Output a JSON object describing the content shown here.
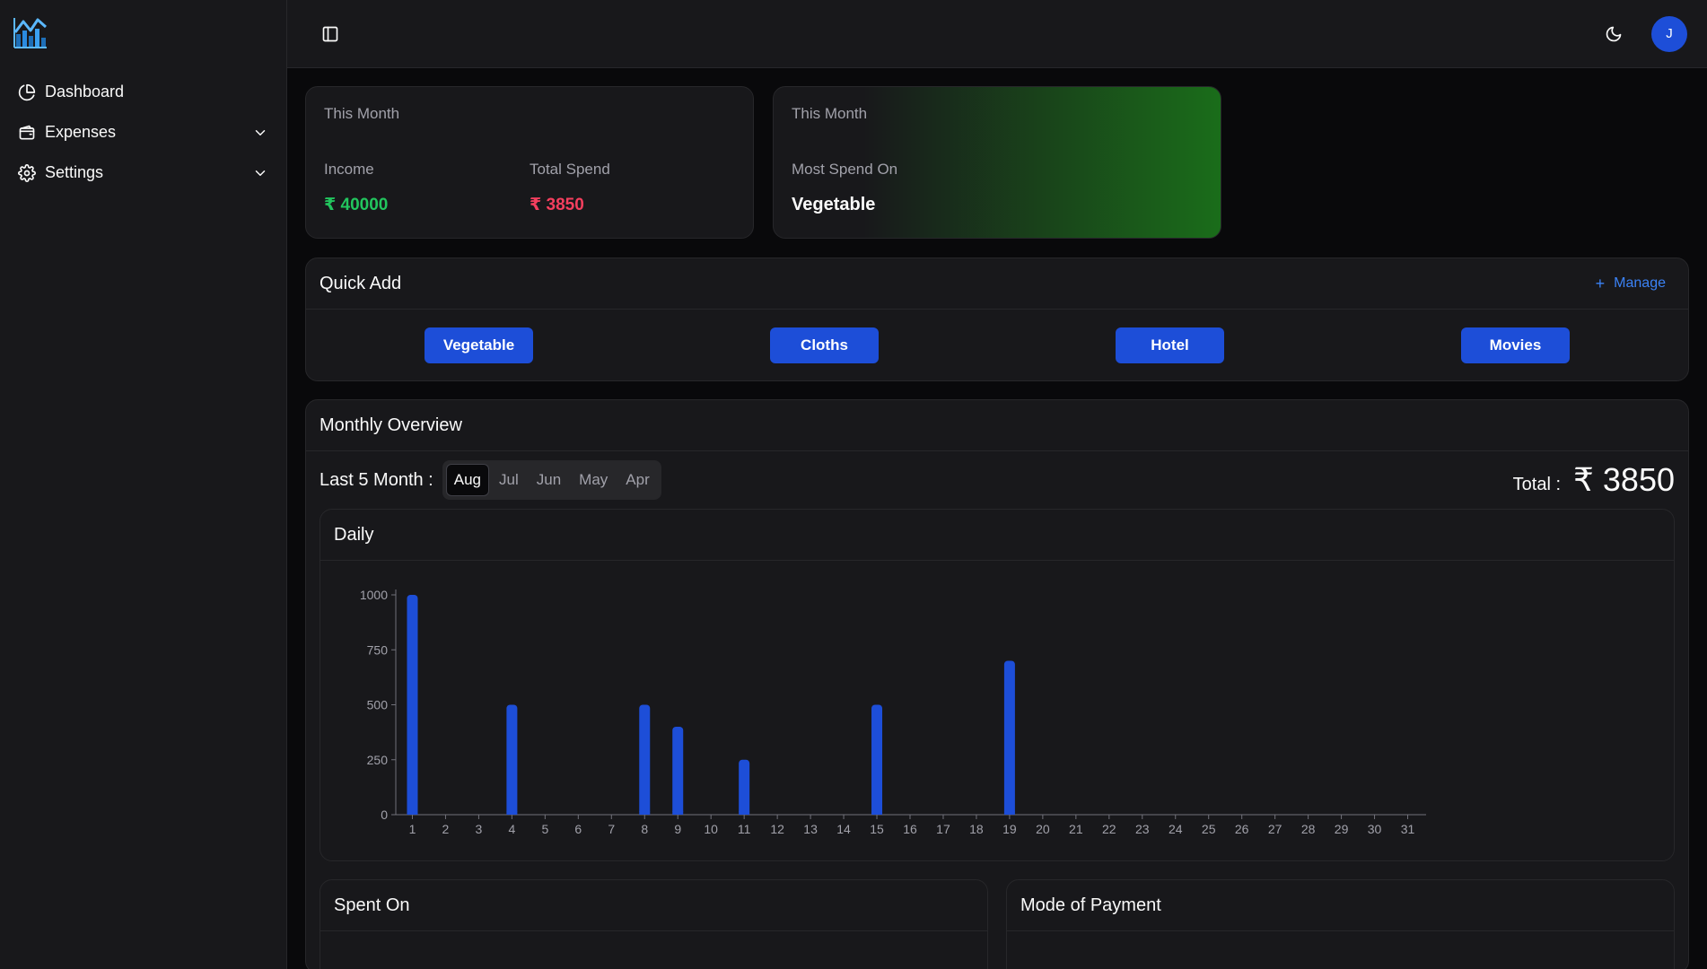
{
  "sidebar": {
    "items": [
      {
        "label": "Dashboard",
        "icon": "pie-chart-icon",
        "expandable": false
      },
      {
        "label": "Expenses",
        "icon": "wallet-icon",
        "expandable": true
      },
      {
        "label": "Settings",
        "icon": "gear-icon",
        "expandable": true
      }
    ]
  },
  "topbar": {
    "avatar_initial": "J"
  },
  "summary": {
    "eyebrow": "This Month",
    "income_label": "Income",
    "income_value": "₹ 40000",
    "spend_label": "Total Spend",
    "spend_value": "₹ 3850"
  },
  "most_spend": {
    "eyebrow": "This Month",
    "label": "Most Spend On",
    "value": "Vegetable"
  },
  "quick_add": {
    "title": "Quick Add",
    "manage_label": "Manage",
    "buttons": [
      "Vegetable",
      "Cloths",
      "Hotel",
      "Movies"
    ]
  },
  "overview": {
    "title": "Monthly Overview",
    "last_label": "Last 5 Month :",
    "months": [
      "Aug",
      "Jul",
      "Jun",
      "May",
      "Apr"
    ],
    "active_month": "Aug",
    "total_label": "Total :",
    "total_value": "₹ 3850"
  },
  "daily": {
    "title": "Daily"
  },
  "bottom": {
    "spent_on_title": "Spent On",
    "payment_title": "Mode of Payment"
  },
  "colors": {
    "accent": "#1d4ed8",
    "income": "#22c55e",
    "spend": "#f43f5e",
    "bar": "#1d4ed8"
  },
  "chart_data": {
    "type": "bar",
    "title": "Daily",
    "xlabel": "",
    "ylabel": "",
    "categories": [
      "1",
      "2",
      "3",
      "4",
      "5",
      "6",
      "7",
      "8",
      "9",
      "10",
      "11",
      "12",
      "13",
      "14",
      "15",
      "16",
      "17",
      "18",
      "19",
      "20",
      "21",
      "22",
      "23",
      "24",
      "25",
      "26",
      "27",
      "28",
      "29",
      "30",
      "31"
    ],
    "values": [
      1000,
      0,
      0,
      500,
      0,
      0,
      0,
      500,
      400,
      0,
      250,
      0,
      0,
      0,
      500,
      0,
      0,
      0,
      700,
      0,
      0,
      0,
      0,
      0,
      0,
      0,
      0,
      0,
      0,
      0,
      0
    ],
    "yticks": [
      0,
      250,
      500,
      750,
      1000
    ],
    "ylim": [
      0,
      1000
    ],
    "grid": false
  }
}
